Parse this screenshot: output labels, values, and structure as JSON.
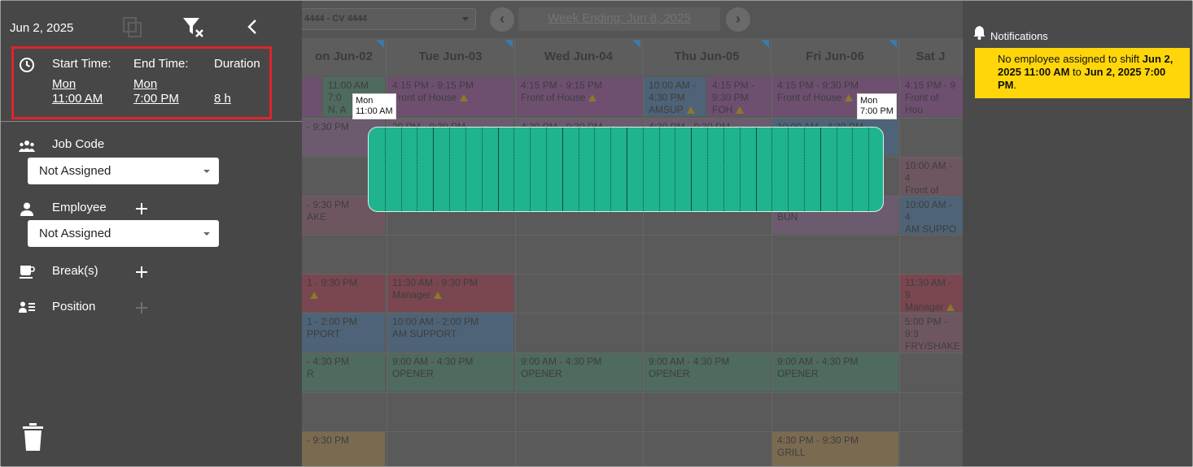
{
  "panel": {
    "date": "Jun 2, 2025",
    "start_label": "Start Time:",
    "end_label": "End Time:",
    "duration_label": "Duration",
    "start_day": "Mon",
    "start_time": "11:00 AM",
    "end_day": "Mon",
    "end_time": "7:00 PM",
    "duration": "8 h",
    "job_code_label": "Job Code",
    "job_code_value": "Not Assigned",
    "employee_label": "Employee",
    "employee_value": "Not Assigned",
    "breaks_label": "Break(s)",
    "position_label": "Position"
  },
  "schedule": {
    "location": "4444 - CV 4444",
    "week_label": "Week Ending: Jun 8, 2025",
    "days": [
      "on Jun-02",
      "Tue Jun-03",
      "Wed Jun-04",
      "Thu Jun-05",
      "Fri Jun-06",
      "Sat J"
    ],
    "shifts": {
      "s1": "11:00 AM",
      "s1b": "7:0",
      "s1c": "N. A",
      "s2a": "4:15 PM - 9:15 PM",
      "s2b": "Front of House",
      "s3a": "4:15 PM - 9:15 PM",
      "s3b": "Front of House",
      "s4a": "10:00 AM -",
      "s4b": "4:30 PM",
      "s4c": "AMSUP",
      "s5a": "4:15 PM -",
      "s5b": "9:30 PM",
      "s5c": "FOH",
      "s6a": "4:15 PM - 9:30 PM",
      "s6b": "Front of House",
      "s7a": "4:15 PM - 9",
      "s7b": "Front of Hou",
      "r2a": "- 9:30 PM",
      "r2b": "20 PM - 9:30 PM",
      "r2c": "4:30 PM - 9:30 PM",
      "r2d": "4:30 PM - 9:30 PM",
      "r2e": "10:00 AM - 4:30 PM",
      "r3a": "10:00 AM - 4",
      "r3b": "Front of Hou",
      "r4a": "- 9:30 PM",
      "r4b": "AKE",
      "r4c": "BUN",
      "r4d": "10:00 AM - 4",
      "r4e": "AM SUPPO",
      "m1a": "1 - 9:30 PM",
      "m2a": "11:30 AM - 9:30 PM",
      "m2b": "Manager",
      "m3a": "11:30 AM - 9",
      "m3b": "Manager",
      "a1a": "1 - 2:00 PM",
      "a1b": "PPORT",
      "a2a": "10:00 AM - 2:00 PM",
      "a2b": "AM SUPPORT",
      "a3a": "5:00 PM - 9:3",
      "a3b": "FRY/SHAKE",
      "o1a": "- 4:30 PM",
      "o1b": "R",
      "o2a": "9:00 AM - 4:30 PM",
      "o2b": "OPENER",
      "o3a": "9:00 AM - 4:30 PM",
      "o3b": "OPENER",
      "o4a": "9:00 AM - 4:30 PM",
      "o4b": "OPENER",
      "o5a": "9:00 AM - 4:30 PM",
      "o5b": "OPENER",
      "g1a": "- 9:30 PM",
      "g2a": "4:30 PM - 9:30 PM",
      "g2b": "GRILL"
    }
  },
  "ghost": {
    "start_tip_day": "Mon",
    "start_tip_time": "11:00 AM",
    "end_tip_day": "Mon",
    "end_tip_time": "7:00 PM"
  },
  "notifications": {
    "title": "Notifications",
    "msg_prefix": "No employee assigned to shift ",
    "msg_start": "Jun 2, 2025 11:00 AM",
    "msg_mid": " to ",
    "msg_end": "Jun 2, 2025 7:00 PM",
    "msg_suffix": "."
  },
  "colors": {
    "highlight_border": "#e0242b",
    "ghost_shift": "#1fb48c",
    "notification_bg": "#ffd60a"
  },
  "icons": [
    "copy-icon",
    "filter-clear-icon",
    "collapse-icon",
    "clock-icon",
    "people-icon",
    "person-icon",
    "break-icon",
    "position-icon",
    "plus-icon",
    "trash-icon",
    "bell-icon",
    "warning-icon"
  ]
}
